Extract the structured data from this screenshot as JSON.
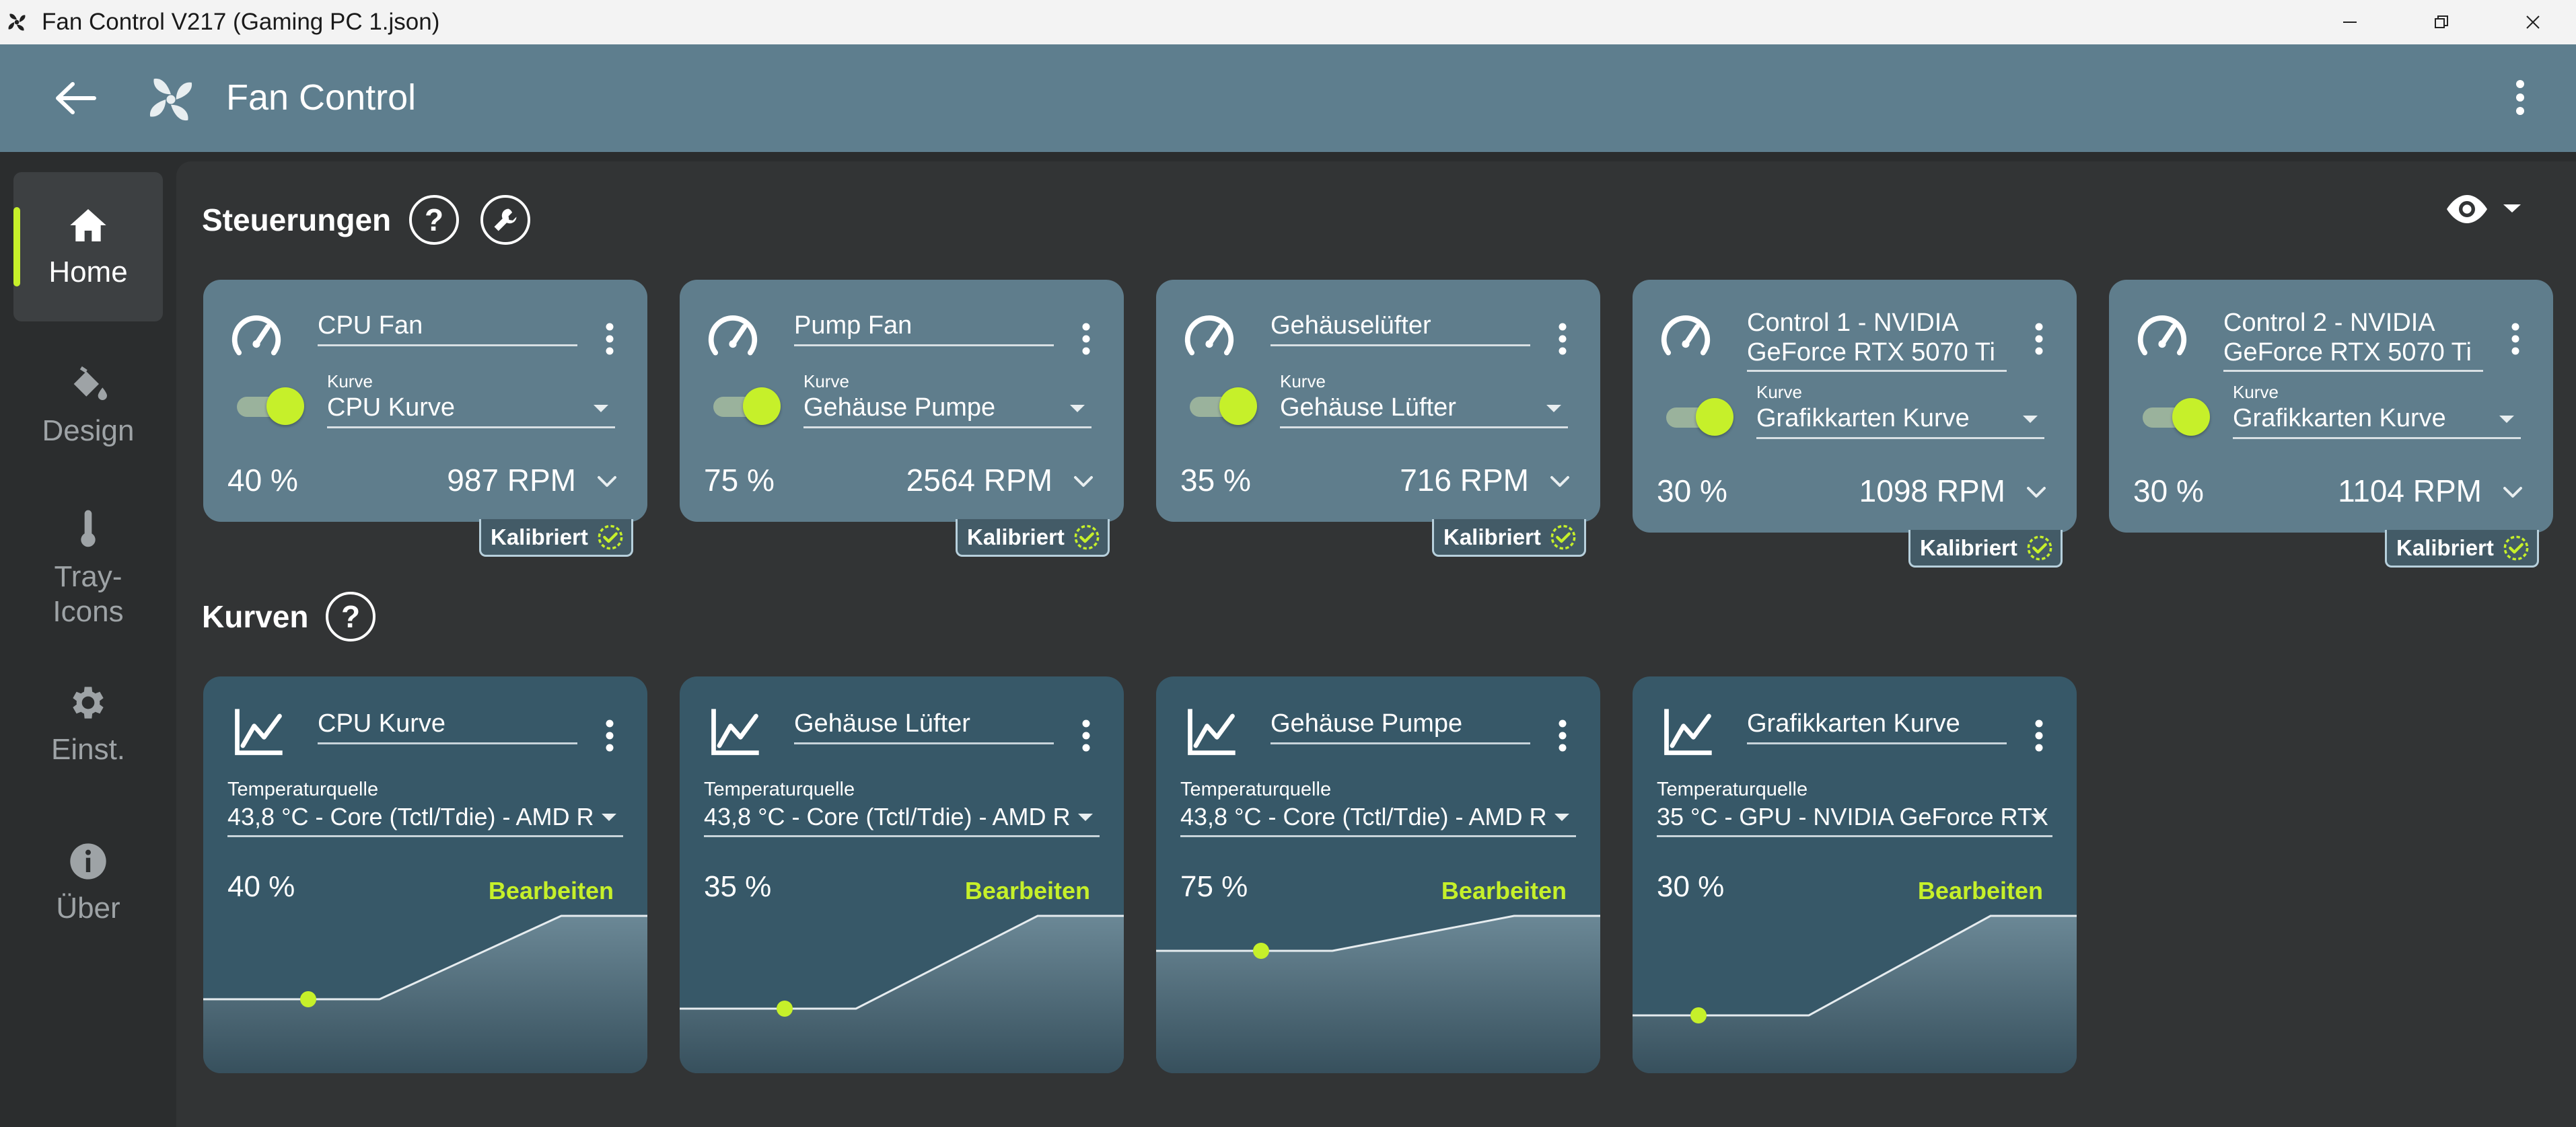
{
  "window": {
    "title": "Fan Control V217 (Gaming PC 1.json)"
  },
  "appbar": {
    "title": "Fan Control"
  },
  "sidebar": {
    "items": [
      {
        "label": "Home",
        "icon": "home-icon",
        "active": true
      },
      {
        "label": "Design",
        "icon": "paint-bucket-icon"
      },
      {
        "label": "Tray-\nIcons",
        "icon": "thermometer-icon"
      },
      {
        "label": "Einst.",
        "icon": "gear-icon"
      },
      {
        "label": "Über",
        "icon": "info-icon"
      }
    ]
  },
  "controls_section": {
    "title": "Steuerungen",
    "cards": [
      {
        "name": "CPU Fan",
        "curve_label": "Kurve",
        "curve": "CPU Kurve",
        "percent": "40 %",
        "rpm": "987 RPM",
        "badge": "Kalibriert",
        "enabled": true
      },
      {
        "name": "Pump Fan",
        "curve_label": "Kurve",
        "curve": "Gehäuse Pumpe",
        "percent": "75 %",
        "rpm": "2564 RPM",
        "badge": "Kalibriert",
        "enabled": true
      },
      {
        "name": "Gehäuselüfter",
        "curve_label": "Kurve",
        "curve": "Gehäuse Lüfter",
        "percent": "35 %",
        "rpm": "716 RPM",
        "badge": "Kalibriert",
        "enabled": true
      },
      {
        "name_line1": "Control 1 - NVIDIA",
        "name_line2": "GeForce RTX 5070 Ti",
        "curve_label": "Kurve",
        "curve": "Grafikkarten Kurve",
        "percent": "30 %",
        "rpm": "1098 RPM",
        "badge": "Kalibriert",
        "enabled": true
      },
      {
        "name_line1": "Control 2 - NVIDIA",
        "name_line2": "GeForce RTX 5070 Ti",
        "curve_label": "Kurve",
        "curve": "Grafikkarten Kurve",
        "percent": "30 %",
        "rpm": "1104 RPM",
        "badge": "Kalibriert",
        "enabled": true
      }
    ]
  },
  "curves_section": {
    "title": "Kurven",
    "cards": [
      {
        "name": "CPU Kurve",
        "source_label": "Temperaturquelle",
        "source": "43,8 °C - Core (Tctl/Tdie) - AMD R",
        "percent": "40 %",
        "edit": "Bearbeiten",
        "current_level": 0.4
      },
      {
        "name": "Gehäuse Lüfter",
        "source_label": "Temperaturquelle",
        "source": "43,8 °C - Core (Tctl/Tdie) - AMD R",
        "percent": "35 %",
        "edit": "Bearbeiten",
        "current_level": 0.35
      },
      {
        "name": "Gehäuse Pumpe",
        "source_label": "Temperaturquelle",
        "source": "43,8 °C - Core (Tctl/Tdie) - AMD R",
        "percent": "75 %",
        "edit": "Bearbeiten",
        "current_level": 0.75
      },
      {
        "name": "Grafikkarten Kurve",
        "source_label": "Temperaturquelle",
        "source": "35 °C - GPU - NVIDIA GeForce RTX",
        "percent": "30 %",
        "edit": "Bearbeiten",
        "current_level": 0.3
      }
    ]
  },
  "colors": {
    "accent": "#c6f02a",
    "header": "#5e7e8e",
    "control_card": "#5f7d8c",
    "curve_card": "#375868"
  }
}
